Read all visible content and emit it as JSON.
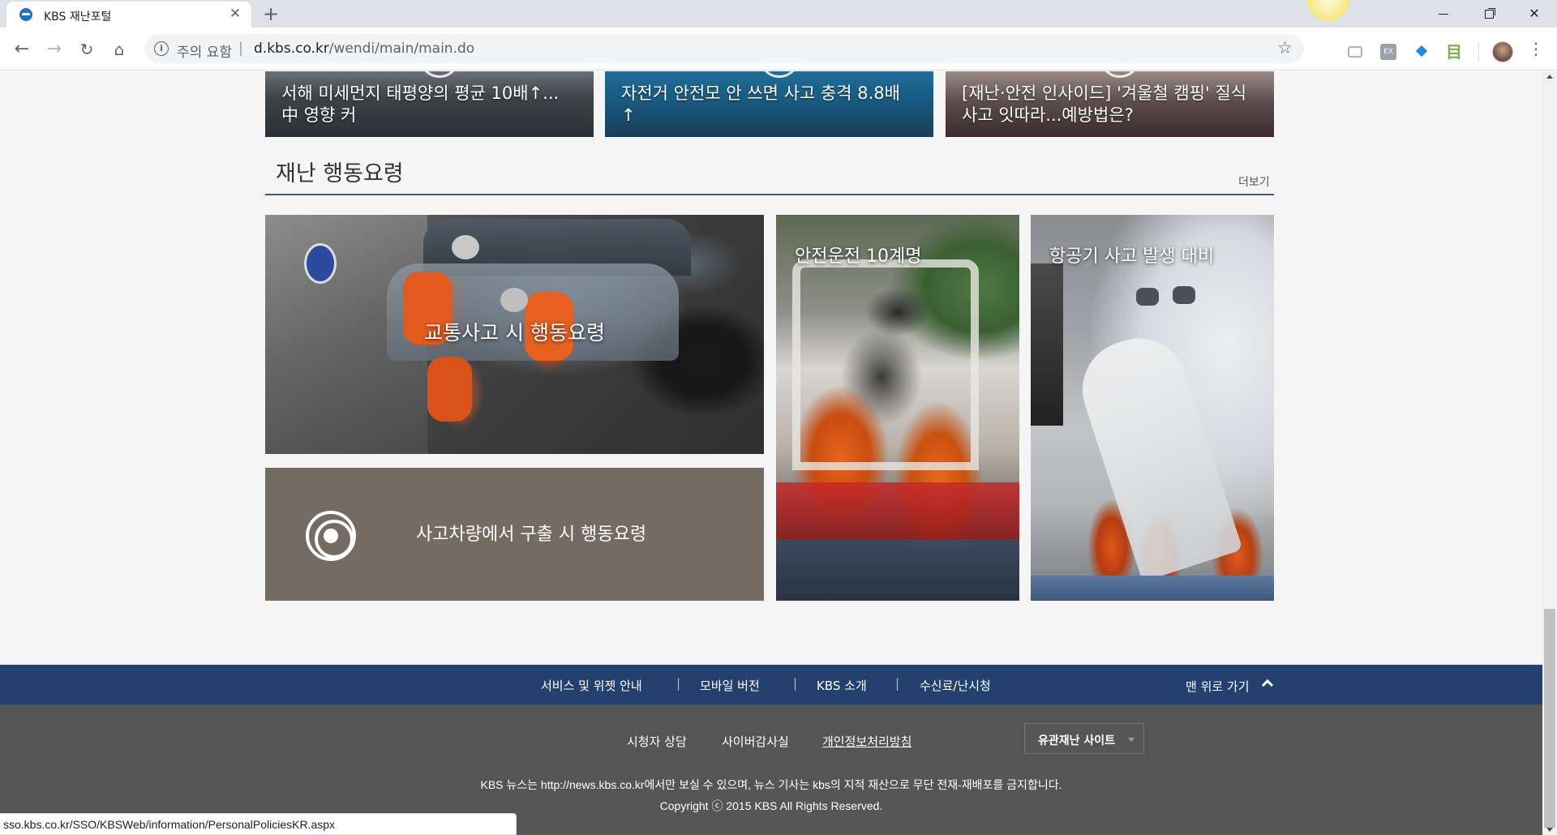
{
  "browser": {
    "tab_title": "KBS 재난포털",
    "tab_close": "✕",
    "new_tab": "+",
    "security_warning": "주의 요함",
    "url_host": "d.kbs.co.kr",
    "url_path": "/wendi/main/main.do",
    "status_url": "sso.kbs.co.kr/SSO/KBSWeb/information/PersonalPoliciesKR.aspx"
  },
  "news_cards": [
    {
      "title": "서해 미세먼지 태평양의 평균 10배↑... 中 영향 커"
    },
    {
      "title": "자전거 안전모 안 쓰면 사고 충격 8.8배 ↑"
    },
    {
      "title": "[재난·안전 인사이드] '겨울철 캠핑' 질식사고 잇따라...예방법은?"
    }
  ],
  "section": {
    "title": "재난 행동요령",
    "more": "더보기"
  },
  "tiles": {
    "traffic": "교통사고 시 행동요령",
    "rescue": "사고차량에서 구출 시 행동요령",
    "safe_driving": "안전운전 10계명",
    "aircraft": "항공기 사고 발생 대비"
  },
  "footer_nav": {
    "items": [
      "서비스 및 위젯 안내",
      "모바일 버전",
      "KBS 소개",
      "수신료/난시청"
    ],
    "separator": "|",
    "back_to_top": "맨 위로 가기"
  },
  "footer_main": {
    "links": [
      "시청자 상담",
      "사이버감사실",
      "개인정보처리방침"
    ],
    "related_sites": "유관재난 사이트",
    "notice": "KBS 뉴스는 http://news.kbs.co.kr에서만 보실 수 있으며, 뉴스 기사는 kbs의 지적 재산으로 무단 전재-재배포를 금지합니다.",
    "copyright": "Copyright ⓒ 2015 KBS All Rights Reserved."
  },
  "icons": {
    "back": "←",
    "forward": "→",
    "reload": "↻",
    "home": "⌂",
    "star": "☆",
    "menu": "⋮",
    "ext_ex": "EX",
    "ext_arrow": "⯁",
    "ext_ladder": "目"
  }
}
